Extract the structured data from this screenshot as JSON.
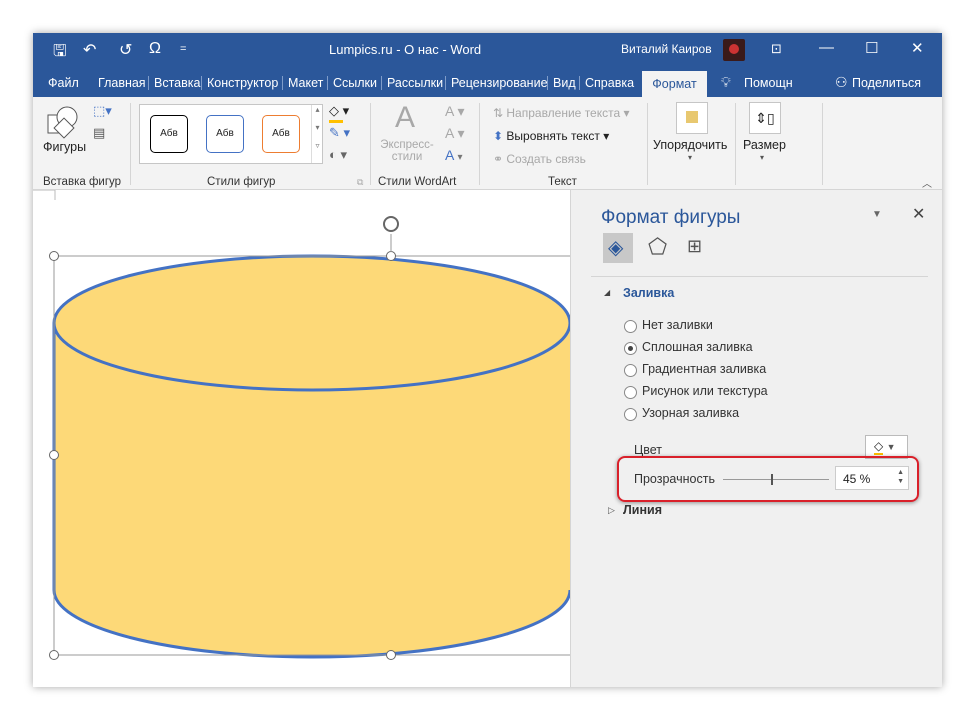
{
  "titlebar": {
    "title": "Lumpics.ru - О нас  -  Word",
    "user": "Виталий Каиров",
    "qat": {
      "save": "save-icon",
      "undo": "↶",
      "redo": "↺",
      "symbol": "Ω",
      "customize": "="
    },
    "buttons": {
      "ribbon_display": "ribbon-display-icon",
      "minimize": "—",
      "maximize": "☐",
      "close": "✕"
    }
  },
  "tabs": [
    "Файл",
    "Главная",
    "Вставка",
    "Конструктор",
    "Макет",
    "Ссылки",
    "Рассылки",
    "Рецензирование",
    "Вид",
    "Справка"
  ],
  "active_tab": "Формат",
  "tell_me": "Помощн",
  "share": "Поделиться",
  "ribbon": {
    "insert_shapes": {
      "shapes_label": "Фигуры",
      "group": "Вставка фигур"
    },
    "shape_styles": {
      "samples": [
        "Абв",
        "Абв",
        "Абв"
      ],
      "sample_colors": [
        "#000000",
        "#4472c4",
        "#ed7d31"
      ],
      "group": "Стили фигур"
    },
    "wordart": {
      "quick_styles": "Экспресс-стили",
      "group": "Стили WordArt"
    },
    "text": {
      "direction": "Направление текста",
      "align": "Выровнять текст",
      "link": "Создать связь",
      "group": "Текст"
    },
    "arrange": "Упорядочить",
    "size": "Размер"
  },
  "document": {
    "shape": "cylinder",
    "fill": "#fdd978",
    "stroke": "#4472c4"
  },
  "pane": {
    "title": "Формат фигуры",
    "fill_section": "Заливка",
    "options": [
      {
        "label": "Нет заливки",
        "selected": false
      },
      {
        "label": "Сплошная заливка",
        "selected": true
      },
      {
        "label": "Градиентная заливка",
        "selected": false
      },
      {
        "label": "Рисунок или текстура",
        "selected": false
      },
      {
        "label": "Узорная заливка",
        "selected": false
      }
    ],
    "color_label": "Цвет",
    "transparency_label": "Прозрачность",
    "transparency_value": "45 %",
    "transparency_percent": 45,
    "line_section": "Линия"
  }
}
